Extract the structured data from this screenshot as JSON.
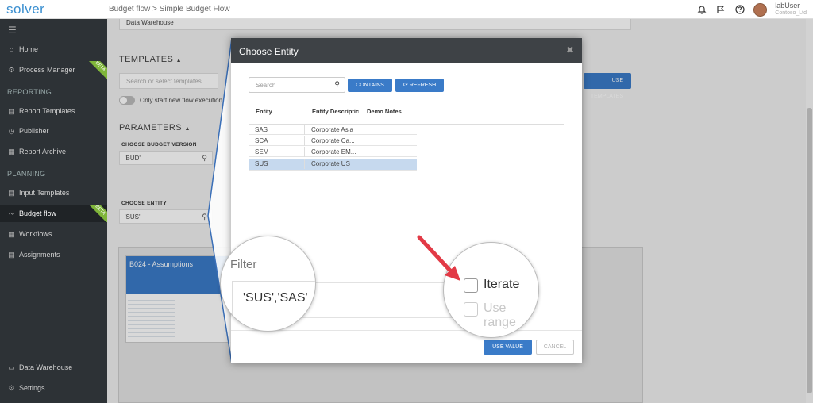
{
  "app": {
    "logo": "solver",
    "breadcrumb": "Budget flow  >  Simple Budget Flow",
    "user_name": "labUser",
    "user_company": "Contoso_Ltd"
  },
  "sidebar": {
    "items": [
      {
        "label": "Home",
        "icon": "home-icon"
      },
      {
        "label": "Process Manager",
        "icon": "process-manager-icon",
        "badge": "BETA"
      },
      {
        "label": "Report Templates",
        "icon": "report-templates-icon"
      },
      {
        "label": "Publisher",
        "icon": "publisher-icon"
      },
      {
        "label": "Report Archive",
        "icon": "report-archive-icon"
      },
      {
        "label": "Input Templates",
        "icon": "input-templates-icon"
      },
      {
        "label": "Budget flow",
        "icon": "budget-flow-icon",
        "badge": "BETA"
      },
      {
        "label": "Workflows",
        "icon": "workflows-icon"
      },
      {
        "label": "Assignments",
        "icon": "assignments-icon"
      },
      {
        "label": "Data Warehouse",
        "icon": "data-warehouse-icon"
      },
      {
        "label": "Settings",
        "icon": "settings-icon"
      }
    ],
    "sections": {
      "reporting": "REPORTING",
      "planning": "PLANNING"
    }
  },
  "main": {
    "data_warehouse_value": "Data Warehouse",
    "templates_title": "TEMPLATES",
    "templates_search_placeholder": "Search or select templates",
    "toggle_label": "Only start new flow execution",
    "use_templates_button": "USE TEMPLATES",
    "parameters_title": "PARAMETERS",
    "budget_version_label": "CHOOSE BUDGET VERSION",
    "budget_version_value": "'BUD'",
    "entity_label": "CHOOSE ENTITY",
    "entity_value": "'SUS'",
    "card_title": "B024 - Assumptions"
  },
  "modal": {
    "title": "Choose Entity",
    "search_placeholder": "Search",
    "contains_button": "CONTAINS",
    "refresh_button": "REFRESH",
    "columns": [
      "Entity",
      "Entity Descriptic",
      "Demo Notes"
    ],
    "rows": [
      {
        "entity": "SAS",
        "description": "Corporate Asia"
      },
      {
        "entity": "SCA",
        "description": "Corporate Ca..."
      },
      {
        "entity": "SEM",
        "description": "Corporate EM..."
      },
      {
        "entity": "SUS",
        "description": "Corporate US"
      }
    ],
    "selected_row": "SUS",
    "use_value_button": "USE VALUE",
    "cancel_button": "CANCEL"
  },
  "magnifier_filter": {
    "label": "Filter",
    "value": "'SUS','SAS'"
  },
  "magnifier_options": {
    "iterate_label": "Iterate",
    "use_range_label": "Use range"
  },
  "colors": {
    "accent": "#3a7bc8",
    "sidebar_bg": "#2d3236",
    "modal_header": "#3e4246",
    "beta_badge": "#7fb53a",
    "arrow": "#e23a46"
  }
}
